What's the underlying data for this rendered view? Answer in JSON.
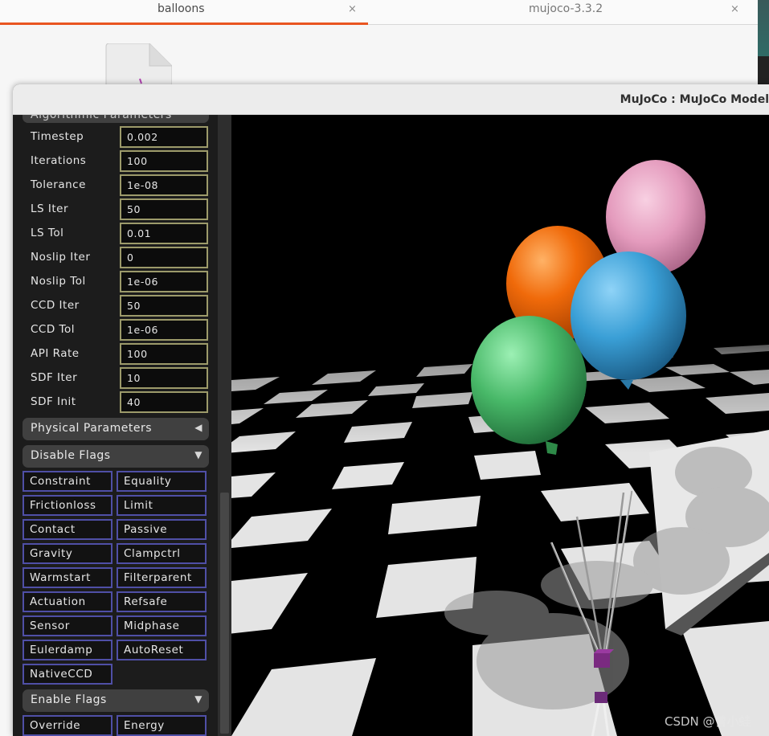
{
  "background": {
    "tabs": [
      {
        "label": "balloons",
        "close": "×"
      },
      {
        "label": "mujoco-3.3.2",
        "close": "×"
      }
    ],
    "accent_color": "#e95420"
  },
  "window": {
    "title": "MuJoCo : MuJoCo Model"
  },
  "sections": {
    "algorithmic": {
      "label": "Algorithmic Parameters",
      "arrow": "▼"
    },
    "physical": {
      "label": "Physical Parameters",
      "arrow": "◀"
    },
    "disable_flags": {
      "label": "Disable Flags",
      "arrow": "▼"
    },
    "enable_flags": {
      "label": "Enable Flags",
      "arrow": "▼"
    }
  },
  "params": [
    {
      "label": "Timestep",
      "value": "0.002"
    },
    {
      "label": "Iterations",
      "value": "100"
    },
    {
      "label": "Tolerance",
      "value": "1e-08"
    },
    {
      "label": "LS Iter",
      "value": "50"
    },
    {
      "label": "LS Tol",
      "value": "0.01"
    },
    {
      "label": "Noslip Iter",
      "value": "0"
    },
    {
      "label": "Noslip Tol",
      "value": "1e-06"
    },
    {
      "label": "CCD Iter",
      "value": "50"
    },
    {
      "label": "CCD Tol",
      "value": "1e-06"
    },
    {
      "label": "API Rate",
      "value": "100"
    },
    {
      "label": "SDF Iter",
      "value": "10"
    },
    {
      "label": "SDF Init",
      "value": "40"
    }
  ],
  "disable_flags": [
    "Constraint",
    "Equality",
    "Frictionloss",
    "Limit",
    "Contact",
    "Passive",
    "Gravity",
    "Clampctrl",
    "Warmstart",
    "Filterparent",
    "Actuation",
    "Refsafe",
    "Sensor",
    "Midphase",
    "Eulerdamp",
    "AutoReset",
    "NativeCCD"
  ],
  "enable_flags": [
    "Override",
    "Energy"
  ],
  "scene": {
    "balloons": [
      {
        "name": "orange-balloon",
        "color": "#f06a0a"
      },
      {
        "name": "pink-balloon",
        "color": "#e9a3c4"
      },
      {
        "name": "blue-balloon",
        "color": "#3aa0d8"
      },
      {
        "name": "green-balloon",
        "color": "#48b868"
      }
    ],
    "weight_color": "#7a2a80"
  },
  "watermark": "CSDN @曾小蛙"
}
